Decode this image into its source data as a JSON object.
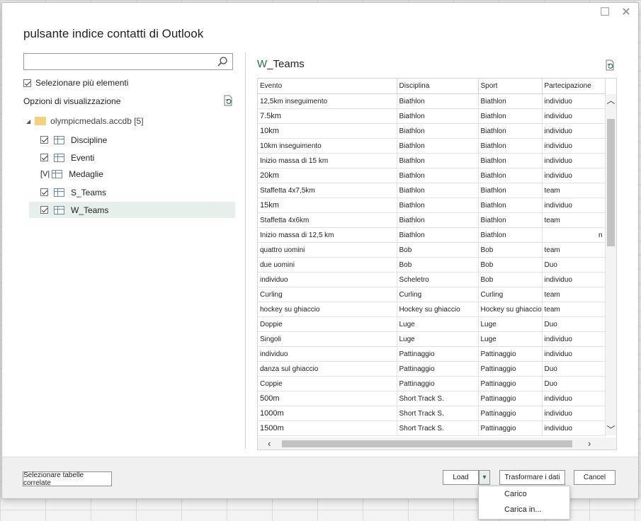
{
  "dialog": {
    "title": "pulsante indice contatti di Outlook"
  },
  "navigator": {
    "search_placeholder": "",
    "multi_select_label": "Selezionare più elementi",
    "display_options_label": "Opzioni di visualizzazione",
    "root": {
      "label": "olympicmedals.accdb [5]"
    },
    "items": [
      {
        "label": "Discipline",
        "checked": true
      },
      {
        "label": "Eventi",
        "checked": true
      },
      {
        "label": "Medaglie",
        "checked": true,
        "prefix": "[V|"
      },
      {
        "label": "S_Teams",
        "checked": true
      },
      {
        "label": "W_Teams",
        "checked": true,
        "selected": true
      }
    ]
  },
  "preview": {
    "title_prefix": "W",
    "title_rest": "_Teams",
    "columns": [
      "Evento",
      "Disciplina",
      "Sport",
      "Partecipazione"
    ],
    "rows": [
      [
        "12,5km inseguimento",
        "Biathlon",
        "Biathlon",
        "individuo"
      ],
      [
        "7.5km",
        "Biathlon",
        "Biathlon",
        "individuo"
      ],
      [
        "10km",
        "Biathlon",
        "Biathlon",
        "individuo"
      ],
      [
        "10km inseguimento",
        "Biathlon",
        "Biathlon",
        "individuo"
      ],
      [
        "Inizio massa di 15 km",
        "Biathlon",
        "Biathlon",
        "individuo"
      ],
      [
        "20km",
        "Biathlon",
        "Biathlon",
        "individuo"
      ],
      [
        "Staffetta 4x7,5km",
        "Biathlon",
        "Biathlon",
        "team"
      ],
      [
        "15km",
        "Biathlon",
        "Biathlon",
        "individuo"
      ],
      [
        "Staffetta 4x6km",
        "Biathlon",
        "Biathlon",
        "team"
      ],
      [
        "Inizio massa di 12,5 km",
        "Biathlon",
        "Biathlon",
        "n"
      ],
      [
        "quattro uomini",
        "Bob",
        "Bob",
        "team"
      ],
      [
        "due uomini",
        "Bob",
        "Bob",
        "Duo"
      ],
      [
        "individuo",
        "Scheletro",
        "Bob",
        "individuo"
      ],
      [
        "Curling",
        "Curling",
        "Curling",
        "team"
      ],
      [
        "hockey su ghiaccio",
        "Hockey su ghiaccio",
        "Hockey su ghiaccio",
        "team"
      ],
      [
        "Doppie",
        "Luge",
        "Luge",
        "Duo"
      ],
      [
        "Singoli",
        "Luge",
        "Luge",
        "individuo"
      ],
      [
        "individuo",
        "Pattinaggio",
        "Pattinaggio",
        "individuo"
      ],
      [
        "danza sul ghiaccio",
        "Pattinaggio",
        "Pattinaggio",
        "Duo"
      ],
      [
        "Coppie",
        "Pattinaggio",
        "Pattinaggio",
        "Duo"
      ],
      [
        "500m",
        "Short Track S.",
        "Pattinaggio",
        "individuo"
      ],
      [
        "1000m",
        "Short Track S.",
        "Pattinaggio",
        "individuo"
      ],
      [
        "1500m",
        "Short Track S.",
        "Pattinaggio",
        "individuo"
      ]
    ]
  },
  "footer": {
    "related_tables_label": "Selezionare tabelle correlate",
    "load_label": "Load",
    "transform_label": "Trasformare i dati",
    "cancel_label": "Cancel"
  },
  "load_menu": {
    "items": [
      "Carico",
      "Carica in..."
    ]
  },
  "colors": {
    "accent": "#217346",
    "selected_row": "#e6efe9"
  }
}
